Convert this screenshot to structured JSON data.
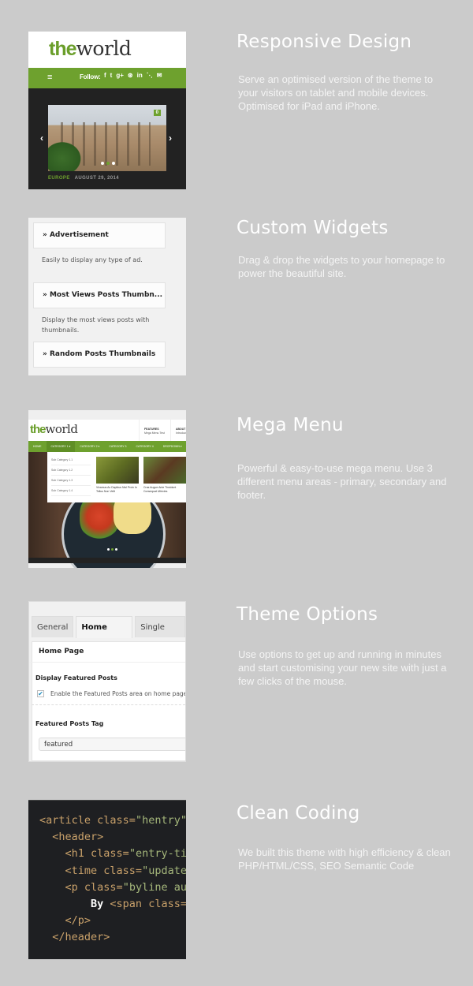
{
  "features": [
    {
      "title": "Responsive Design",
      "description": "Serve an optimised version of the theme to your visitors on tablet and mobile devices. Optimised for iPad and iPhone."
    },
    {
      "title": "Custom Widgets",
      "description": "Drag & drop the widgets to your homepage to power the beautiful site."
    },
    {
      "title": "Mega Menu",
      "description": "Powerful & easy-to-use mega menu. Use 3 different menu areas - primary, secondary and footer."
    },
    {
      "title": "Theme Options",
      "description": "Use options to get up and running in minutes and start customising your new site with just a few clicks of the mouse."
    },
    {
      "title": "Clean Coding",
      "description": "We built this theme with high efficiency & clean PHP/HTML/CSS, SEO Semantic Code"
    }
  ],
  "brand": {
    "logo_the": "the",
    "logo_world": "world",
    "accent_color": "#6ea12e"
  },
  "responsive_preview": {
    "menu_icon": "≡",
    "follow_label": "Follow:",
    "social_icons": [
      "f",
      "🐦",
      "g+",
      "⊛",
      "in",
      "rss",
      "✉"
    ],
    "comment_count": "0",
    "category": "EUROPE",
    "date": "AUGUST 29, 2014",
    "prev_arrow": "‹",
    "next_arrow": "›"
  },
  "widgets_preview": {
    "widgets": [
      {
        "title": "» Advertisement",
        "description": "Easily to display any type of ad."
      },
      {
        "title": "» Most Views Posts Thumbn...",
        "description": "Display the most views posts with thumbnails."
      },
      {
        "title": "» Random Posts Thumbnails"
      }
    ]
  },
  "megamenu_preview": {
    "header_links": [
      {
        "title": "FEATURES",
        "sub": "Mega Menu Test"
      },
      {
        "title": "ABOUT",
        "sub": "Introduction"
      }
    ],
    "menu_items": [
      "HOME",
      "CATEGORY 1 ▾",
      "CATEGORY 2 ▾",
      "CATEGORY 3",
      "CATEGORY 4",
      "DROPDOWN ▾"
    ],
    "sub_categories": [
      "Sub Category 1.1",
      "Sub Category 1.2",
      "Sub Category 1.3",
      "Sub Category 1.4"
    ],
    "posts": [
      {
        "caption": "Vivamus Ac Dapibus Nisl Proin In Tellus Non Velit"
      },
      {
        "caption": "Cras Augue Ante Tincidunt Consequat Ultricies"
      }
    ]
  },
  "options_preview": {
    "tabs": [
      "General",
      "Home Page",
      "Single Post"
    ],
    "active_tab": "Home Page",
    "panel_title": "Home Page",
    "featured_label": "Display Featured Posts",
    "checkbox_label": "Enable the Featured Posts area on home page",
    "checkbox_checked": true,
    "tag_label": "Featured Posts Tag",
    "tag_value": "featured"
  },
  "code_preview": {
    "lines": [
      {
        "indent": "",
        "tag": "<article ",
        "attr": "class=",
        "str": "\"hentry\"",
        "rest": ">"
      },
      {
        "indent": "  ",
        "tag": "<header>",
        "attr": "",
        "str": "",
        "rest": ""
      },
      {
        "indent": "    ",
        "tag": "<h1 ",
        "attr": "class=",
        "str": "\"entry-title\"",
        "rest": ""
      },
      {
        "indent": "    ",
        "tag": "<time ",
        "attr": "class=",
        "str": "\"updated\"",
        "rest": ""
      },
      {
        "indent": "    ",
        "tag": "<p ",
        "attr": "class=",
        "str": "\"byline author\"",
        "rest": ""
      },
      {
        "indent": "        ",
        "plain": "By ",
        "tag": "<span ",
        "attr": "class=",
        "str": "",
        "rest": ""
      },
      {
        "indent": "    ",
        "tag": "</p>",
        "attr": "",
        "str": "",
        "rest": ""
      },
      {
        "indent": "  ",
        "tag": "</header>",
        "attr": "",
        "str": "",
        "rest": ""
      }
    ]
  }
}
